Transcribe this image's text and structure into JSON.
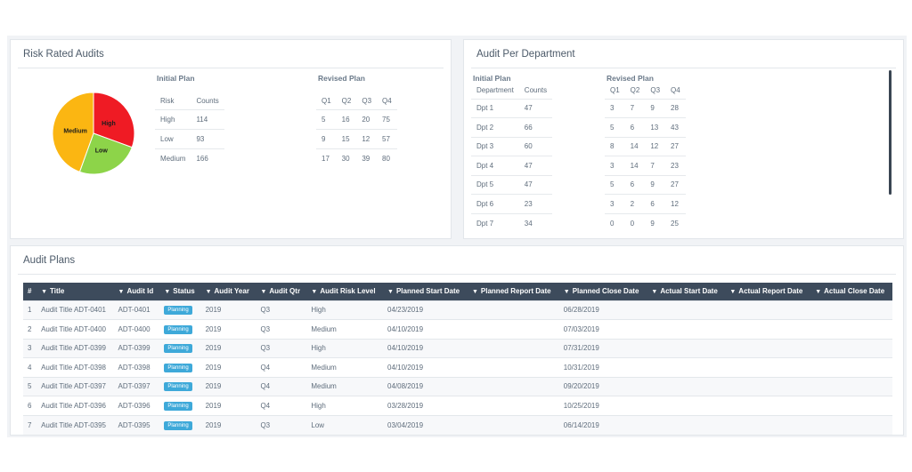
{
  "risk_panel": {
    "title": "Risk Rated Audits",
    "initial_label": "Initial Plan",
    "revised_label": "Revised Plan",
    "initial_headers": [
      "Risk",
      "Counts"
    ],
    "initial_rows": [
      [
        "High",
        "114"
      ],
      [
        "Low",
        "93"
      ],
      [
        "Medium",
        "166"
      ]
    ],
    "revised_headers": [
      "Q1",
      "Q2",
      "Q3",
      "Q4"
    ],
    "revised_rows": [
      [
        "5",
        "16",
        "20",
        "75"
      ],
      [
        "9",
        "15",
        "12",
        "57"
      ],
      [
        "17",
        "30",
        "39",
        "80"
      ]
    ],
    "pie": {
      "slices": [
        {
          "label": "High",
          "value": 114,
          "color": "#ef1b24"
        },
        {
          "label": "Low",
          "value": 93,
          "color": "#8dd449"
        },
        {
          "label": "Medium",
          "value": 166,
          "color": "#fbb612"
        }
      ]
    }
  },
  "dept_panel": {
    "title": "Audit Per Department",
    "initial_label": "Initial Plan",
    "revised_label": "Revised Plan",
    "initial_headers": [
      "Department",
      "Counts"
    ],
    "initial_rows": [
      [
        "Dpt 1",
        "47"
      ],
      [
        "Dpt 2",
        "66"
      ],
      [
        "Dpt 3",
        "60"
      ],
      [
        "Dpt 4",
        "47"
      ],
      [
        "Dpt 5",
        "47"
      ],
      [
        "Dpt 6",
        "23"
      ],
      [
        "Dpt 7",
        "34"
      ]
    ],
    "revised_headers": [
      "Q1",
      "Q2",
      "Q3",
      "Q4"
    ],
    "revised_rows": [
      [
        "3",
        "7",
        "9",
        "28"
      ],
      [
        "5",
        "6",
        "13",
        "43"
      ],
      [
        "8",
        "14",
        "12",
        "27"
      ],
      [
        "3",
        "14",
        "7",
        "23"
      ],
      [
        "5",
        "6",
        "9",
        "27"
      ],
      [
        "3",
        "2",
        "6",
        "12"
      ],
      [
        "0",
        "0",
        "9",
        "25"
      ]
    ]
  },
  "plans_panel": {
    "title": "Audit Plans",
    "columns": [
      "#",
      "Title",
      "Audit Id",
      "Status",
      "Audit Year",
      "Audit Qtr",
      "Audit Risk Level",
      "Planned Start Date",
      "Planned Report Date",
      "Planned Close Date",
      "Actual Start Date",
      "Actual Report Date",
      "Actual Close Date"
    ],
    "rows": [
      [
        "1",
        "Audit Title ADT-0401",
        "ADT-0401",
        "Planning",
        "2019",
        "Q3",
        "High",
        "04/23/2019",
        "",
        "06/28/2019",
        "",
        "",
        ""
      ],
      [
        "2",
        "Audit Title ADT-0400",
        "ADT-0400",
        "Planning",
        "2019",
        "Q3",
        "Medium",
        "04/10/2019",
        "",
        "07/03/2019",
        "",
        "",
        ""
      ],
      [
        "3",
        "Audit Title ADT-0399",
        "ADT-0399",
        "Planning",
        "2019",
        "Q3",
        "High",
        "04/10/2019",
        "",
        "07/31/2019",
        "",
        "",
        ""
      ],
      [
        "4",
        "Audit Title ADT-0398",
        "ADT-0398",
        "Planning",
        "2019",
        "Q4",
        "Medium",
        "04/10/2019",
        "",
        "10/31/2019",
        "",
        "",
        ""
      ],
      [
        "5",
        "Audit Title ADT-0397",
        "ADT-0397",
        "Planning",
        "2019",
        "Q4",
        "Medium",
        "04/08/2019",
        "",
        "09/20/2019",
        "",
        "",
        ""
      ],
      [
        "6",
        "Audit Title ADT-0396",
        "ADT-0396",
        "Planning",
        "2019",
        "Q4",
        "High",
        "03/28/2019",
        "",
        "10/25/2019",
        "",
        "",
        ""
      ],
      [
        "7",
        "Audit Title ADT-0395",
        "ADT-0395",
        "Planning",
        "2019",
        "Q3",
        "Low",
        "03/04/2019",
        "",
        "06/14/2019",
        "",
        "",
        ""
      ]
    ]
  },
  "colors": {
    "header_bg": "#3d4b5c",
    "badge": "#3ea9d9",
    "pie_high": "#ef1b24",
    "pie_low": "#8dd449",
    "pie_medium": "#fbb612"
  },
  "icons": {
    "filter": "filter-icon"
  }
}
